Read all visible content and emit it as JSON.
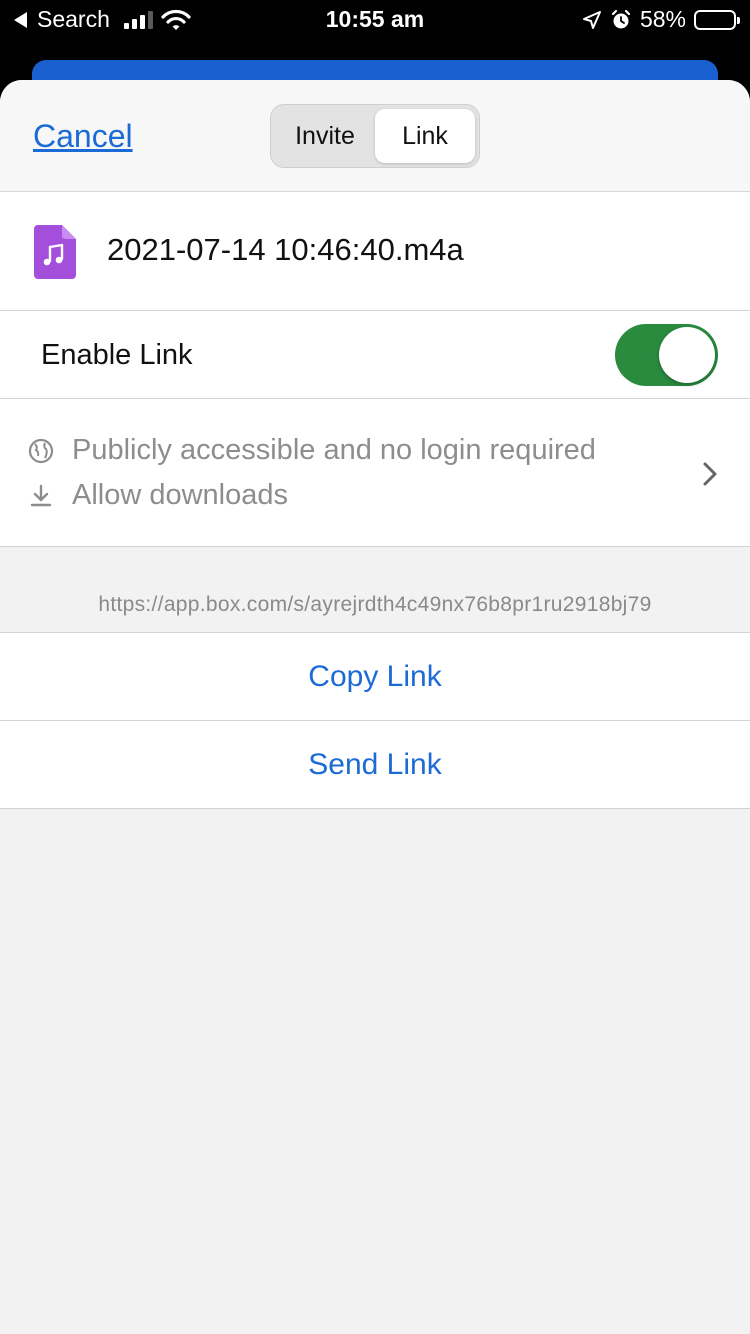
{
  "status_bar": {
    "back_label": "Search",
    "time": "10:55 am",
    "battery": "58%",
    "battery_level": 0.58
  },
  "nav": {
    "cancel_label": "Cancel",
    "tabs": [
      {
        "label": "Invite",
        "active": false
      },
      {
        "label": "Link",
        "active": true
      }
    ]
  },
  "file": {
    "name": "2021-07-14 10:46:40.m4a",
    "icon": "music-file-icon",
    "icon_color": "#a44fdc"
  },
  "link_settings": {
    "enable_label": "Enable Link",
    "enabled": true,
    "toggle_color": "#2a8a3e",
    "access_text": "Publicly accessible and no login required",
    "download_text": "Allow downloads"
  },
  "shared_url": "https://app.box.com/s/ayrejrdth4c49nx76b8pr1ru2918bj79",
  "actions": {
    "copy_label": "Copy Link",
    "send_label": "Send Link"
  },
  "accent_color": "#1b6bd6"
}
